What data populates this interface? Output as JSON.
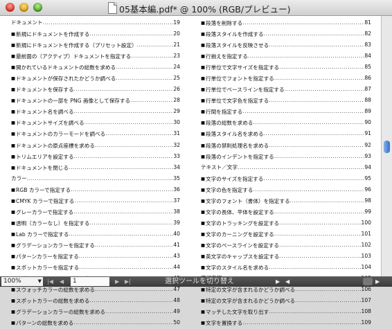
{
  "window": {
    "title": "05基本編.pdf* @ 100% (RGB/プレビュー)"
  },
  "toc_left": [
    {
      "label": "ドキュメント",
      "page": "19",
      "bullet": false
    },
    {
      "label": "新規にドキュメントを作成する",
      "page": "20",
      "bullet": true
    },
    {
      "label": "新規にドキュメントを作成する（プリセット設定）",
      "page": "21",
      "bullet": true
    },
    {
      "label": "最前面の（アクティブ）ドキュメントを指定する",
      "page": "23",
      "bullet": true
    },
    {
      "label": "開かれているドキュメントの総数を求める",
      "page": "24",
      "bullet": true
    },
    {
      "label": "ドキュメントが保存されたかどうか調べる",
      "page": "25",
      "bullet": true
    },
    {
      "label": "ドキュメントを保存する",
      "page": "26",
      "bullet": true
    },
    {
      "label": "ドキュメントの一部を PNG 画像として保存する",
      "page": "28",
      "bullet": true
    },
    {
      "label": "ドキュメント名を調べる",
      "page": "29",
      "bullet": true
    },
    {
      "label": "ドキュメントサイズを調べる",
      "page": "30",
      "bullet": true
    },
    {
      "label": "ドキュメントのカラーモードを調べる",
      "page": "31",
      "bullet": true
    },
    {
      "label": "ドキュメントの原点座標を求める",
      "page": "32",
      "bullet": true
    },
    {
      "label": "トリムエリアを設定する",
      "page": "33",
      "bullet": true
    },
    {
      "label": "ドキュメントを閉じる",
      "page": "34",
      "bullet": true
    },
    {
      "label": "カラー",
      "page": "35",
      "bullet": false
    },
    {
      "label": "RGB カラーで指定する",
      "page": "36",
      "bullet": true
    },
    {
      "label": "CMYK カラーで指定する",
      "page": "37",
      "bullet": true
    },
    {
      "label": "グレーカラーで指定する",
      "page": "38",
      "bullet": true
    },
    {
      "label": "透明（カラーなし）を指定する",
      "page": "39",
      "bullet": true
    },
    {
      "label": "Lab カラーで指定する",
      "page": "40",
      "bullet": true
    },
    {
      "label": "グラデーションカラーを指定する",
      "page": "41",
      "bullet": true
    },
    {
      "label": "パターンカラーを指定する",
      "page": "43",
      "bullet": true
    },
    {
      "label": "スポットカラーを指定する",
      "page": "44",
      "bullet": true
    },
    {
      "label": "オブジェクトのカラーを読み出す",
      "page": "45",
      "bullet": true
    },
    {
      "label": "スウォッチカラーの総数を求める",
      "page": "47",
      "bullet": true
    },
    {
      "label": "スポットカラーの総数を求める",
      "page": "48",
      "bullet": true
    },
    {
      "label": "グラデーションカラーの総数を求める",
      "page": "49",
      "bullet": true
    },
    {
      "label": "パターンの総数を求める",
      "page": "50",
      "bullet": true
    }
  ],
  "toc_right": [
    {
      "label": "段落を削除する",
      "page": "81",
      "bullet": true
    },
    {
      "label": "段落スタイルを作成する",
      "page": "82",
      "bullet": true
    },
    {
      "label": "段落スタイルを反映させる",
      "page": "83",
      "bullet": true
    },
    {
      "label": "行揃えを指定する",
      "page": "84",
      "bullet": true
    },
    {
      "label": "行単位で文字サイズを指定する",
      "page": "85",
      "bullet": true
    },
    {
      "label": "行単位でフォントを指定する",
      "page": "86",
      "bullet": true
    },
    {
      "label": "行単位でベースラインを指定する",
      "page": "87",
      "bullet": true
    },
    {
      "label": "行単位で文字色を指定する",
      "page": "88",
      "bullet": true
    },
    {
      "label": "行間を指定する",
      "page": "89",
      "bullet": true
    },
    {
      "label": "段落の総数を求める",
      "page": "90",
      "bullet": true
    },
    {
      "label": "段落スタイル名を求める",
      "page": "91",
      "bullet": true
    },
    {
      "label": "段落の禁則処理名を求める",
      "page": "92",
      "bullet": true
    },
    {
      "label": "段落のインデントを指定する",
      "page": "93",
      "bullet": true
    },
    {
      "label": "テキスト／文字",
      "page": "94",
      "bullet": false
    },
    {
      "label": "文字のサイズを指定する",
      "page": "95",
      "bullet": true
    },
    {
      "label": "文字の色を指定する",
      "page": "96",
      "bullet": true
    },
    {
      "label": "文字のフォント（書体）を指定する",
      "page": "98",
      "bullet": true
    },
    {
      "label": "文字の長体、平体を設定する",
      "page": "99",
      "bullet": true
    },
    {
      "label": "文字のトラッキングを設定する",
      "page": "100",
      "bullet": true
    },
    {
      "label": "文字のカーニングを設定する",
      "page": "101",
      "bullet": true
    },
    {
      "label": "文字のベースラインを設定する",
      "page": "102",
      "bullet": true
    },
    {
      "label": "英文字のキャップスを設定する",
      "page": "103",
      "bullet": true
    },
    {
      "label": "文字のスタイル名を求める",
      "page": "104",
      "bullet": true
    },
    {
      "label": "正規表現",
      "page": "105",
      "bullet": false
    },
    {
      "label": "特定の文字が含まれるかどうか調べる",
      "page": "106",
      "bullet": true
    },
    {
      "label": "特定の文字が含まれるかどうか調べる",
      "page": "107",
      "bullet": true
    },
    {
      "label": "マッチした文字を取り出す",
      "page": "108",
      "bullet": true
    },
    {
      "label": "文字を置換する",
      "page": "109",
      "bullet": true
    }
  ],
  "statusbar": {
    "zoom": "100%",
    "page": "1",
    "status": "選択ツールを切り替え"
  }
}
